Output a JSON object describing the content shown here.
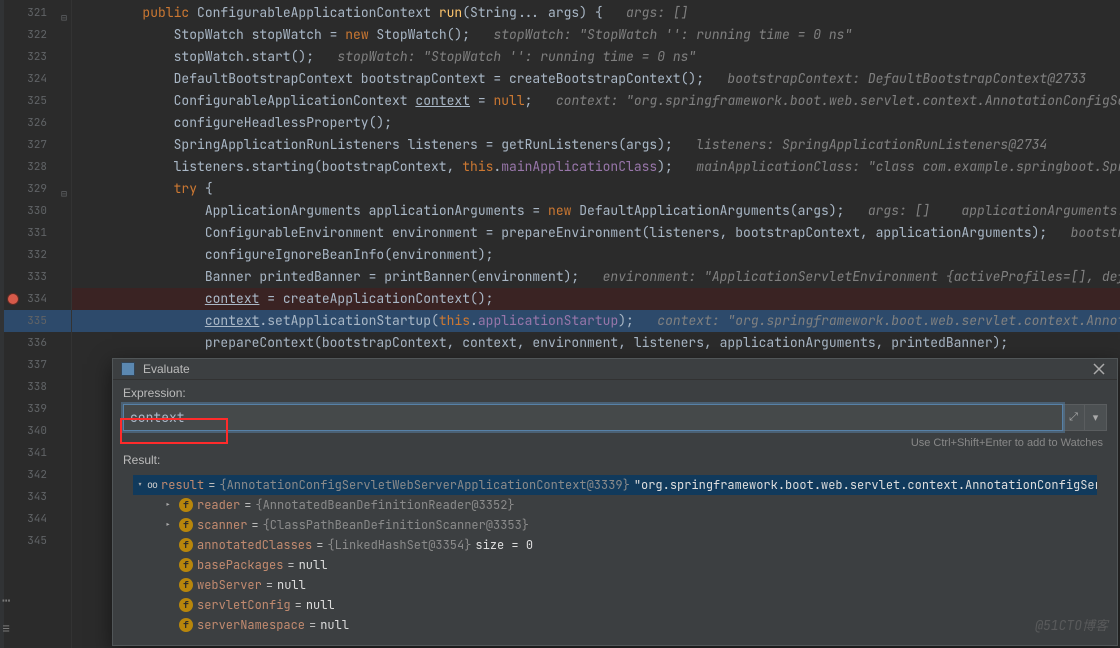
{
  "gutter": {
    "lines": [
      321,
      322,
      323,
      324,
      325,
      326,
      327,
      328,
      329,
      330,
      331,
      332,
      333,
      334,
      335,
      336,
      337,
      338,
      339,
      340,
      341,
      342,
      343,
      344,
      345
    ],
    "breakpointAt": 334,
    "highlightedAt": 335
  },
  "code": {
    "321": {
      "indent": 2,
      "tokens": [
        [
          "kw",
          "public "
        ],
        [
          "type",
          "ConfigurableApplicationContext "
        ],
        [
          "method",
          "run"
        ],
        [
          "pun",
          "(String... args) {   "
        ],
        [
          "cmt",
          "args: []"
        ]
      ]
    },
    "322": {
      "indent": 3,
      "tokens": [
        [
          "type",
          "StopWatch stopWatch = "
        ],
        [
          "kw",
          "new "
        ],
        [
          "type",
          "StopWatch();   "
        ],
        [
          "cmt",
          "stopWatch: \"StopWatch '': running time = 0 ns\""
        ]
      ]
    },
    "323": {
      "indent": 3,
      "tokens": [
        [
          "type",
          "stopWatch.start();   "
        ],
        [
          "cmt",
          "stopWatch: \"StopWatch '': running time = 0 ns\""
        ]
      ]
    },
    "324": {
      "indent": 3,
      "tokens": [
        [
          "type",
          "DefaultBootstrapContext bootstrapContext = createBootstrapContext();   "
        ],
        [
          "cmt",
          "bootstrapContext: DefaultBootstrapContext@2733"
        ]
      ]
    },
    "325": {
      "indent": 3,
      "tokens": [
        [
          "type",
          "ConfigurableApplicationContext "
        ],
        [
          "under",
          "context"
        ],
        [
          "pun",
          " = "
        ],
        [
          "null",
          "null"
        ],
        [
          "pun",
          ";   "
        ],
        [
          "cmt",
          "context: \"org.springframework.boot.web.servlet.context.AnnotationConfigServ"
        ]
      ]
    },
    "326": {
      "indent": 3,
      "tokens": [
        [
          "type",
          "configureHeadlessProperty();"
        ]
      ]
    },
    "327": {
      "indent": 3,
      "tokens": [
        [
          "type",
          "SpringApplicationRunListeners listeners = getRunListeners(args);   "
        ],
        [
          "cmt",
          "listeners: SpringApplicationRunListeners@2734"
        ]
      ]
    },
    "328": {
      "indent": 3,
      "tokens": [
        [
          "type",
          "listeners.starting(bootstrapContext, "
        ],
        [
          "kw",
          "this"
        ],
        [
          "pun",
          "."
        ],
        [
          "field",
          "mainApplicationClass"
        ],
        [
          "pun",
          ");   "
        ],
        [
          "cmt",
          "mainApplicationClass: \"class com.example.springboot.Sprin"
        ]
      ]
    },
    "329": {
      "indent": 3,
      "tokens": [
        [
          "kw",
          "try "
        ],
        [
          "pun",
          "{"
        ]
      ]
    },
    "330": {
      "indent": 4,
      "tokens": [
        [
          "type",
          "ApplicationArguments applicationArguments = "
        ],
        [
          "kw",
          "new "
        ],
        [
          "type",
          "DefaultApplicationArguments(args);   "
        ],
        [
          "cmt",
          "args: []    applicationArguments: D"
        ]
      ]
    },
    "331": {
      "indent": 4,
      "tokens": [
        [
          "type",
          "ConfigurableEnvironment environment = prepareEnvironment(listeners, bootstrapContext, applicationArguments);   "
        ],
        [
          "cmt",
          "bootstrap"
        ]
      ]
    },
    "332": {
      "indent": 4,
      "tokens": [
        [
          "type",
          "configureIgnoreBeanInfo(environment);"
        ]
      ]
    },
    "333": {
      "indent": 4,
      "tokens": [
        [
          "type",
          "Banner printedBanner = printBanner(environment);   "
        ],
        [
          "cmt",
          "environment: \"ApplicationServletEnvironment {activeProfiles=[], defau"
        ]
      ]
    },
    "334": {
      "indent": 4,
      "bp": true,
      "tokens": [
        [
          "under",
          "context"
        ],
        [
          "pun",
          " = createApplicationContext();"
        ]
      ]
    },
    "335": {
      "indent": 4,
      "hl": true,
      "tokens": [
        [
          "under",
          "context"
        ],
        [
          "pun",
          ".setApplicationStartup("
        ],
        [
          "kw",
          "this"
        ],
        [
          "pun",
          "."
        ],
        [
          "field",
          "applicationStartup"
        ],
        [
          "pun",
          ");   "
        ],
        [
          "cmt",
          "context: \"org.springframework.boot.web.servlet.context.Annota"
        ]
      ]
    },
    "336": {
      "indent": 4,
      "tokens": [
        [
          "type",
          "prepareContext(bootstrapContext, context, environment, listeners, applicationArguments, printedBanner);"
        ]
      ]
    }
  },
  "evaluate": {
    "title": "Evaluate",
    "expressionLabel": "Expression:",
    "expressionValue": "context",
    "hint": "Use Ctrl+Shift+Enter to add to Watches",
    "resultLabel": "Result:",
    "tree": {
      "root": {
        "name": "result",
        "cls": "{AnnotationConfigServletWebServerApplicationContext@3339}",
        "val": "\"org.springframework.boot.web.servlet.context.AnnotationConfigServletWebServerApplica"
      },
      "children": [
        {
          "arrow": "right",
          "name": "reader",
          "cls": "{AnnotatedBeanDefinitionReader@3352}"
        },
        {
          "arrow": "right",
          "name": "scanner",
          "cls": "{ClassPathBeanDefinitionScanner@3353}"
        },
        {
          "arrow": "none",
          "name": "annotatedClasses",
          "cls": "{LinkedHashSet@3354}",
          "extra": "  size = 0"
        },
        {
          "arrow": "none",
          "name": "basePackages",
          "val": "null"
        },
        {
          "arrow": "none",
          "name": "webServer",
          "val": "null"
        },
        {
          "arrow": "none",
          "name": "servletConfig",
          "val": "null"
        },
        {
          "arrow": "none",
          "name": "serverNamespace",
          "val": "null"
        }
      ]
    }
  },
  "watermark": "@51CTO博客"
}
